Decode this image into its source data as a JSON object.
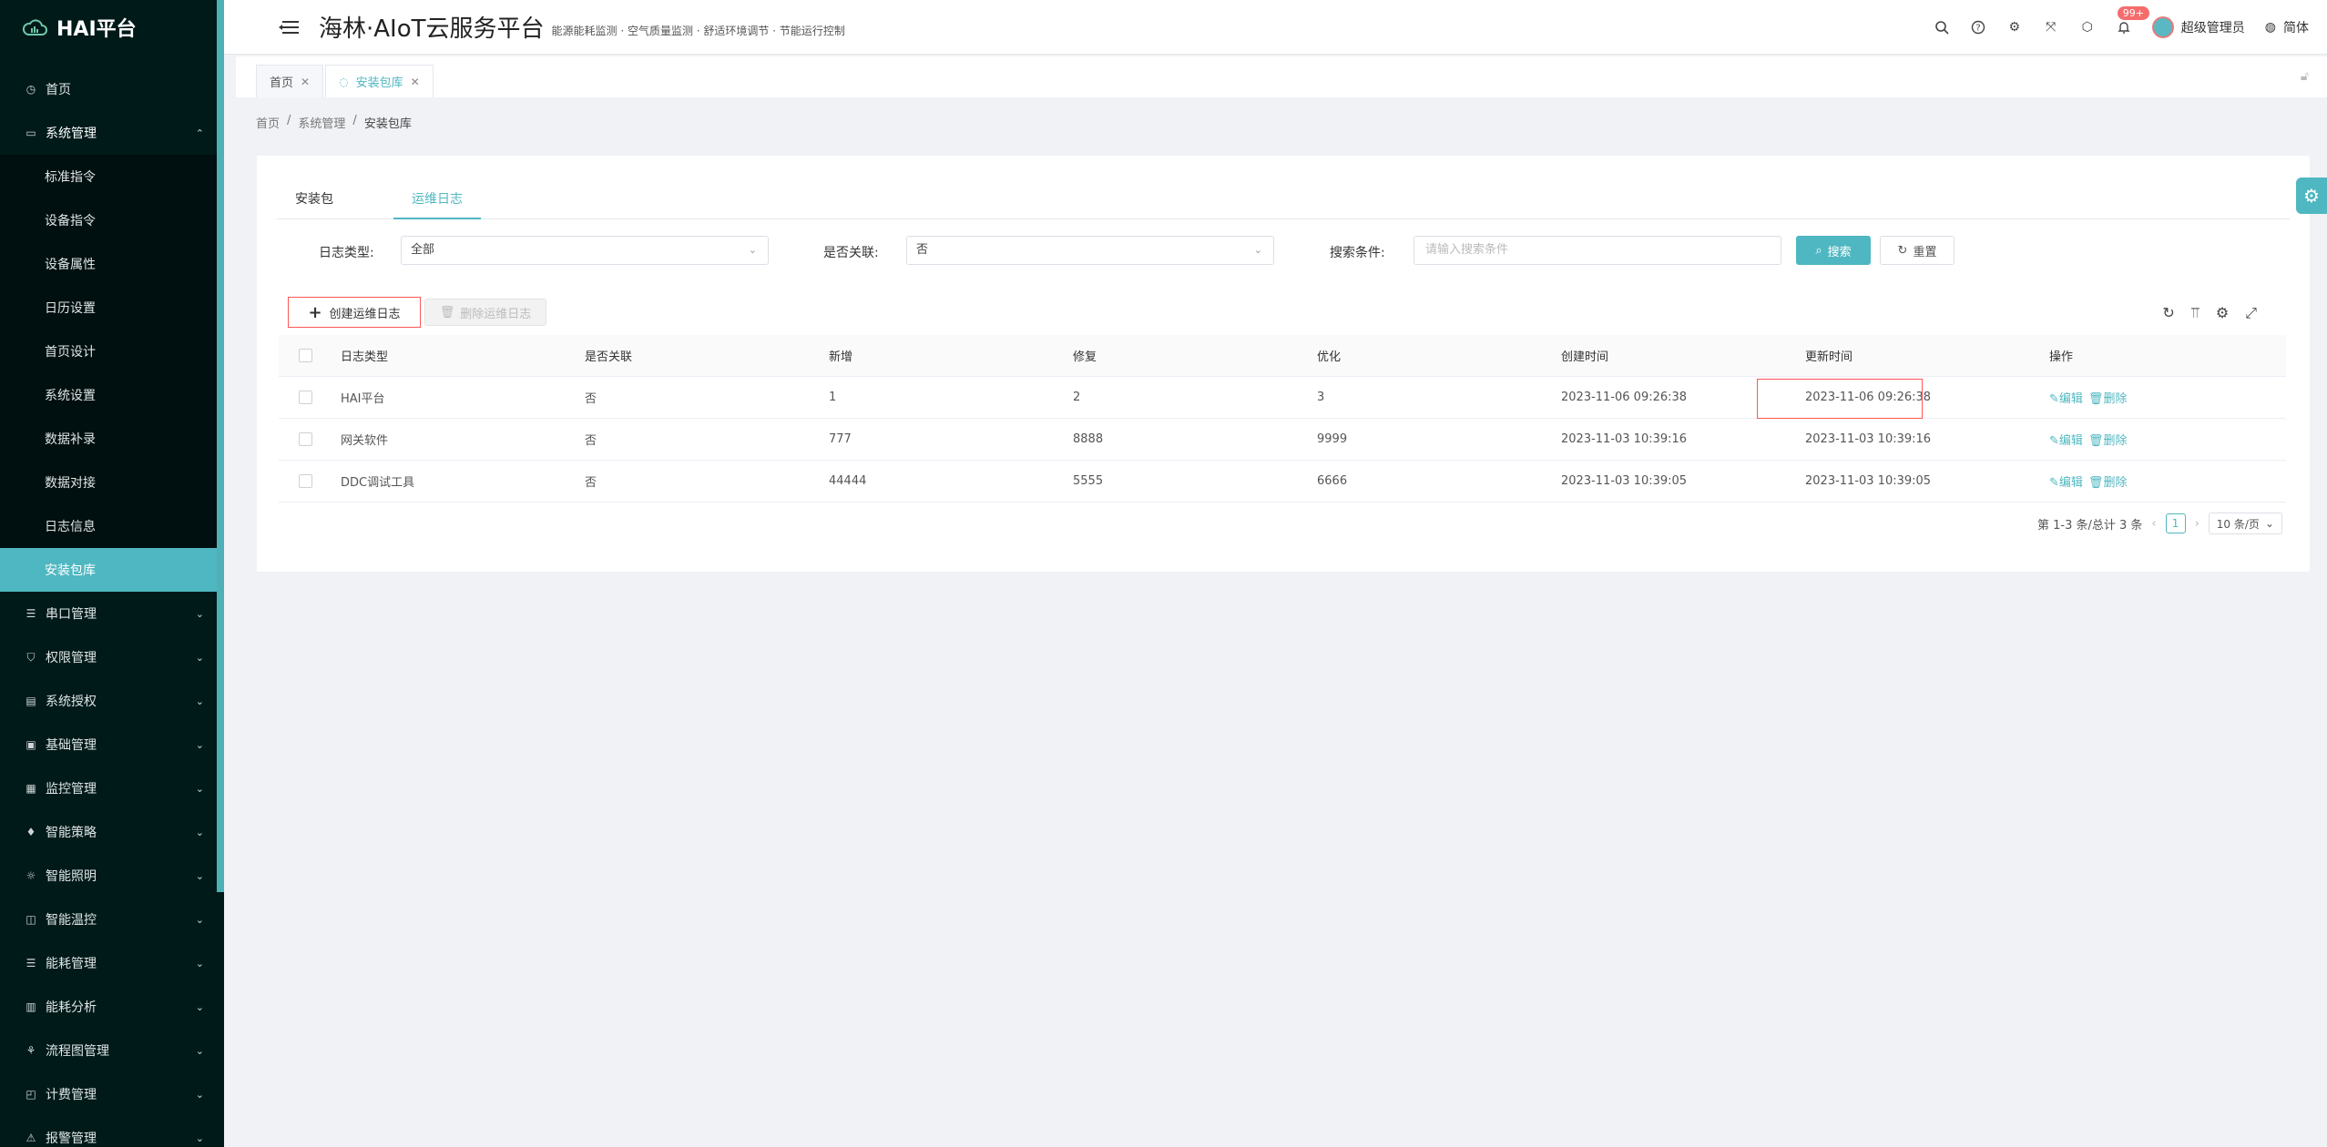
{
  "app": {
    "logo_text": "HAI平台",
    "title": "海林·AIoT云服务平台",
    "subtitle": "能源能耗监测 · 空气质量监测 · 舒适环境调节 · 节能运行控制"
  },
  "header": {
    "notification_count": "99+",
    "user_name": "超级管理员",
    "language": "简体"
  },
  "sidebar": {
    "top_items": [
      {
        "label": "首页",
        "icon": "dashboard-icon"
      }
    ],
    "open_group": {
      "label": "系统管理",
      "icon": "monitor-icon"
    },
    "sub_items": [
      {
        "label": "标准指令"
      },
      {
        "label": "设备指令"
      },
      {
        "label": "设备属性"
      },
      {
        "label": "日历设置"
      },
      {
        "label": "首页设计"
      },
      {
        "label": "系统设置"
      },
      {
        "label": "数据补录"
      },
      {
        "label": "数据对接"
      },
      {
        "label": "日志信息"
      },
      {
        "label": "安装包库"
      }
    ],
    "groups": [
      {
        "label": "串口管理"
      },
      {
        "label": "权限管理"
      },
      {
        "label": "系统授权"
      },
      {
        "label": "基础管理"
      },
      {
        "label": "监控管理"
      },
      {
        "label": "智能策略"
      },
      {
        "label": "智能照明"
      },
      {
        "label": "智能温控"
      },
      {
        "label": "能耗管理"
      },
      {
        "label": "能耗分析"
      },
      {
        "label": "流程图管理"
      },
      {
        "label": "计费管理"
      },
      {
        "label": "报警管理"
      }
    ]
  },
  "tabs": [
    {
      "label": "首页"
    },
    {
      "label": "安装包库"
    }
  ],
  "breadcrumb": [
    "首页",
    "系统管理",
    "安装包库"
  ],
  "content_tabs": [
    {
      "label": "安装包"
    },
    {
      "label": "运维日志"
    }
  ],
  "filters": {
    "log_type_label": "日志类型:",
    "log_type_value": "全部",
    "related_label": "是否关联:",
    "related_value": "否",
    "search_label": "搜索条件:",
    "search_placeholder": "请输入搜索条件",
    "search_button": "搜索",
    "reset_button": "重置"
  },
  "toolbar": {
    "create_label": "创建运维日志",
    "delete_label": "删除运维日志"
  },
  "table": {
    "columns": [
      "日志类型",
      "是否关联",
      "新增",
      "修复",
      "优化",
      "创建时间",
      "更新时间",
      "操作"
    ],
    "rows": [
      {
        "type": "HAI平台",
        "related": "否",
        "add": "1",
        "fix": "2",
        "opt": "3",
        "created": "2023-11-06 09:26:38",
        "updated": "2023-11-06 09:26:38"
      },
      {
        "type": "网关软件",
        "related": "否",
        "add": "777",
        "fix": "8888",
        "opt": "9999",
        "created": "2023-11-03 10:39:16",
        "updated": "2023-11-03 10:39:16"
      },
      {
        "type": "DDC调试工具",
        "related": "否",
        "add": "44444",
        "fix": "5555",
        "opt": "6666",
        "created": "2023-11-03 10:39:05",
        "updated": "2023-11-03 10:39:05"
      }
    ],
    "edit_label": "编辑",
    "delete_label": "删除"
  },
  "pagination": {
    "summary": "第 1-3 条/总计 3 条",
    "current_page": "1",
    "page_size": "10 条/页"
  },
  "colors": {
    "accent": "#4fb7c1",
    "sidebar_bg": "#001a1a",
    "highlight_border": "#ff5555"
  }
}
